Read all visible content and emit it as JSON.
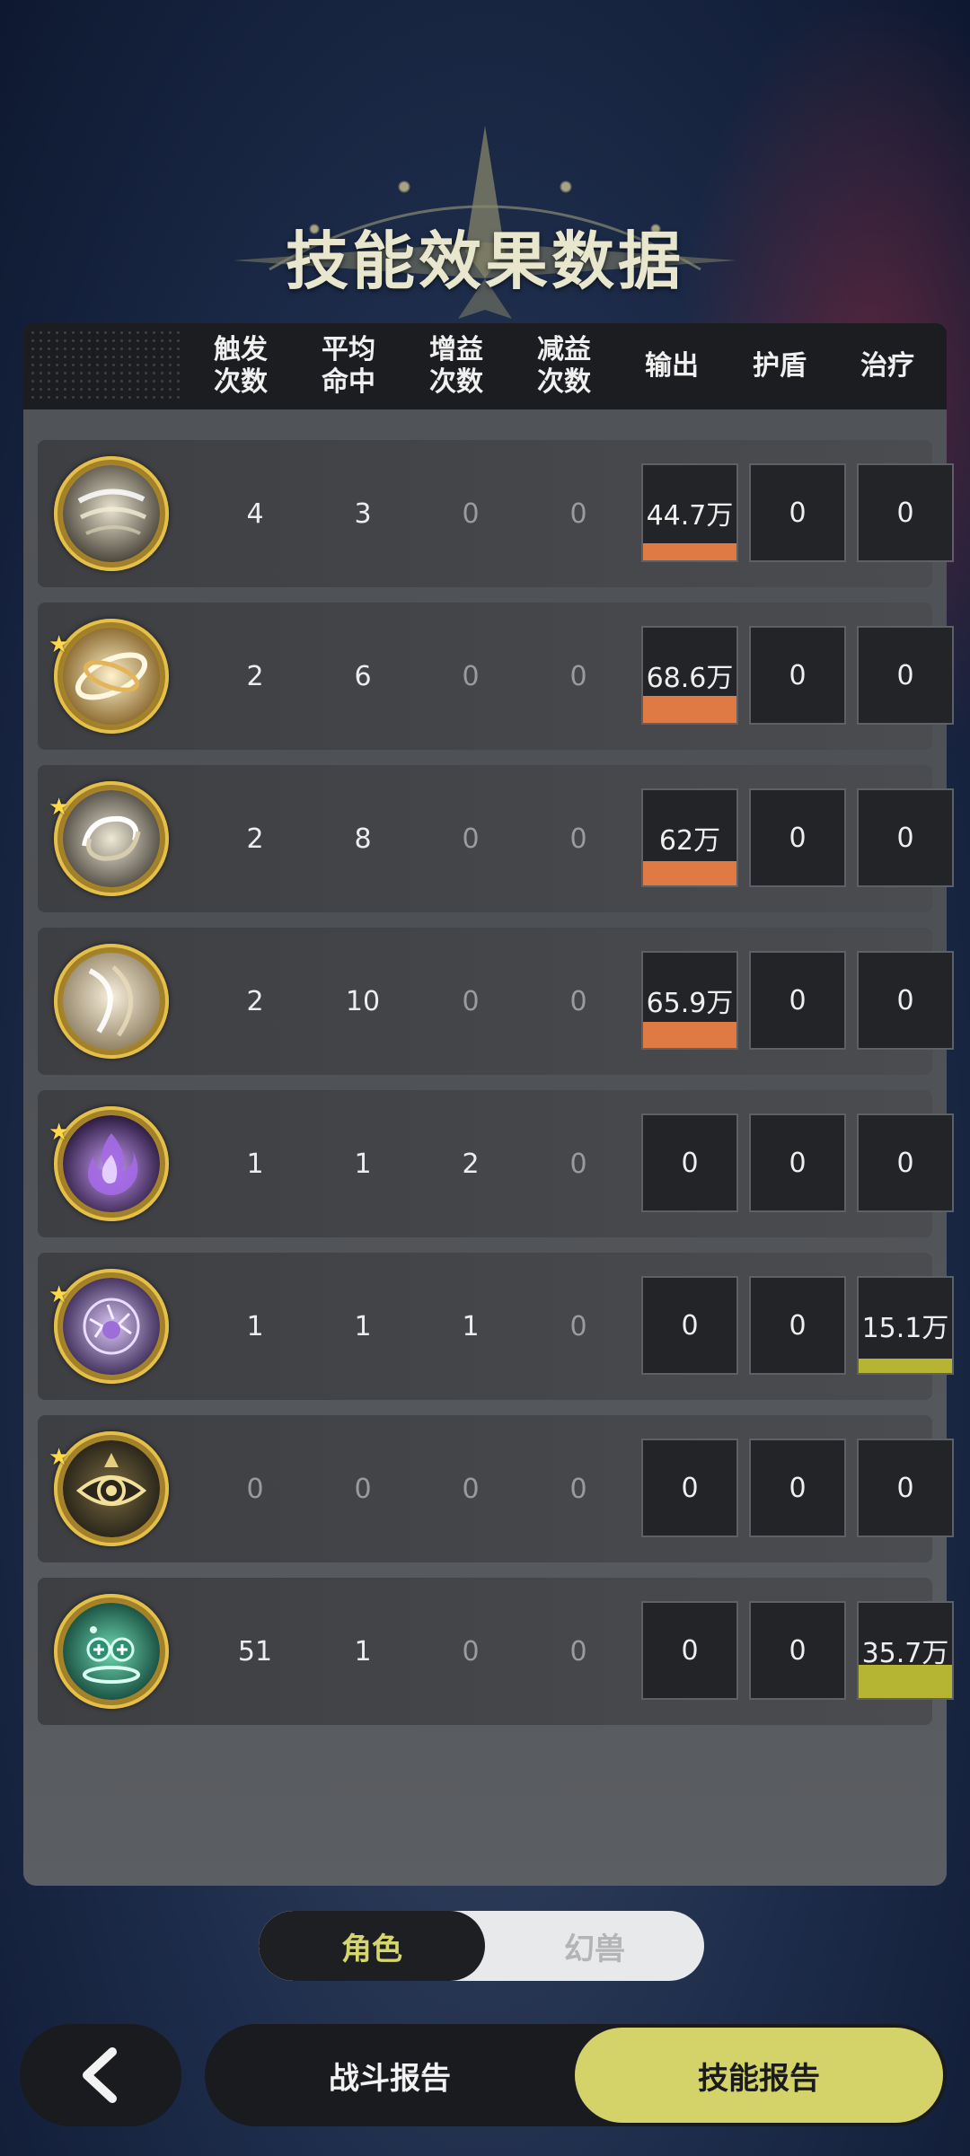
{
  "page": {
    "title": "技能效果数据"
  },
  "header": {
    "columns": [
      {
        "id": "trigger",
        "label": "触发次数",
        "line1": "触发",
        "line2": "次数"
      },
      {
        "id": "avg_hit",
        "label": "平均命中",
        "line1": "平均",
        "line2": "命中"
      },
      {
        "id": "buff",
        "label": "增益次数",
        "line1": "增益",
        "line2": "次数"
      },
      {
        "id": "debuff",
        "label": "减益次数",
        "line1": "减益",
        "line2": "次数"
      },
      {
        "id": "damage",
        "label": "输出",
        "line1": "输出",
        "line2": ""
      },
      {
        "id": "shield",
        "label": "护盾",
        "line1": "护盾",
        "line2": ""
      },
      {
        "id": "heal",
        "label": "治疗",
        "line1": "治疗",
        "line2": ""
      }
    ]
  },
  "rows": [
    {
      "icon": "wind-slash-skill-icon",
      "starred": false,
      "trigger": "4",
      "avg_hit": "3",
      "buff": "0",
      "debuff": "0",
      "damage": "44.7万",
      "damage_fill": 0.18,
      "shield": "0",
      "heal": "0",
      "heal_fill": 0
    },
    {
      "icon": "golden-vortex-skill-icon",
      "starred": true,
      "trigger": "2",
      "avg_hit": "6",
      "buff": "0",
      "debuff": "0",
      "damage": "68.6万",
      "damage_fill": 0.28,
      "shield": "0",
      "heal": "0",
      "heal_fill": 0
    },
    {
      "icon": "spiral-wind-skill-icon",
      "starred": true,
      "trigger": "2",
      "avg_hit": "8",
      "buff": "0",
      "debuff": "0",
      "damage": "62万",
      "damage_fill": 0.25,
      "shield": "0",
      "heal": "0",
      "heal_fill": 0
    },
    {
      "icon": "cyclone-skill-icon",
      "starred": false,
      "trigger": "2",
      "avg_hit": "10",
      "buff": "0",
      "debuff": "0",
      "damage": "65.9万",
      "damage_fill": 0.27,
      "shield": "0",
      "heal": "0",
      "heal_fill": 0
    },
    {
      "icon": "purple-flame-skill-icon",
      "starred": true,
      "trigger": "1",
      "avg_hit": "1",
      "buff": "2",
      "debuff": "0",
      "damage": "0",
      "damage_fill": 0,
      "shield": "0",
      "heal": "0",
      "heal_fill": 0
    },
    {
      "icon": "purple-orb-skill-icon",
      "starred": true,
      "trigger": "1",
      "avg_hit": "1",
      "buff": "1",
      "debuff": "0",
      "damage": "0",
      "damage_fill": 0,
      "shield": "0",
      "heal": "15.1万",
      "heal_fill": 0.15
    },
    {
      "icon": "eye-skill-icon",
      "starred": true,
      "trigger": "0",
      "avg_hit": "0",
      "buff": "0",
      "debuff": "0",
      "damage": "0",
      "damage_fill": 0,
      "shield": "0",
      "heal": "0",
      "heal_fill": 0
    },
    {
      "icon": "healing-skill-icon",
      "starred": false,
      "trigger": "51",
      "avg_hit": "1",
      "buff": "0",
      "debuff": "0",
      "damage": "0",
      "damage_fill": 0,
      "shield": "0",
      "heal": "35.7万",
      "heal_fill": 0.35
    }
  ],
  "toggle": {
    "active": "角色",
    "inactive": "幻兽"
  },
  "bottom_nav": {
    "back_icon": "chevron-left-icon",
    "battle_report": "战斗报告",
    "skill_report": "技能报告"
  },
  "colors": {
    "damage_bar": "#e07a45",
    "heal_bar": "#b5b533",
    "accent": "#d3d36a"
  }
}
